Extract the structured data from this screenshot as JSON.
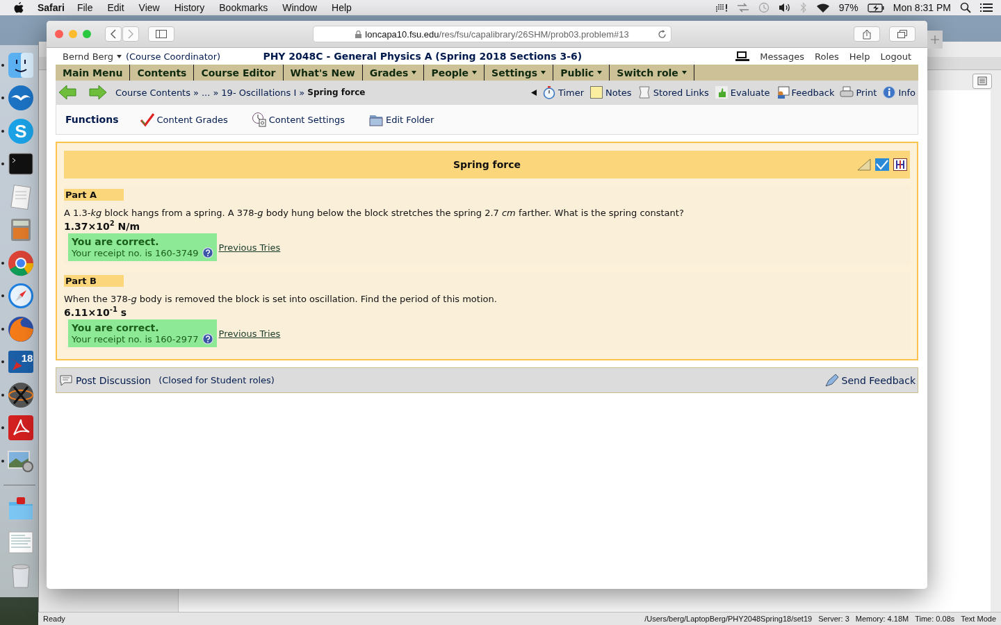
{
  "menubar": {
    "app_name": "Safari",
    "menus": [
      "File",
      "Edit",
      "View",
      "History",
      "Bookmarks",
      "Window",
      "Help"
    ],
    "battery": "97%",
    "clock": "Mon 8:31 PM"
  },
  "dock": [
    {
      "kind": "finder",
      "running": true
    },
    {
      "kind": "gull",
      "running": true
    },
    {
      "kind": "skype",
      "running": true,
      "badge": "S"
    },
    {
      "kind": "terminal",
      "running": true
    },
    {
      "kind": "notepad",
      "running": false
    },
    {
      "kind": "calculator",
      "running": false
    },
    {
      "kind": "chrome",
      "running": true
    },
    {
      "kind": "compass",
      "running": true
    },
    {
      "kind": "globe",
      "running": true
    },
    {
      "kind": "calendar",
      "running": true,
      "badge": "18"
    },
    {
      "kind": "xmark",
      "running": true
    },
    {
      "kind": "pdf",
      "running": true
    },
    {
      "kind": "photo",
      "running": true
    },
    {
      "kind": "divider"
    },
    {
      "kind": "folder",
      "running": false
    },
    {
      "kind": "document",
      "running": false
    },
    {
      "kind": "trash",
      "running": false
    }
  ],
  "browser": {
    "url_host": "loncapa10.fsu.edu",
    "url_path": "/res/fsu/capalibrary/26SHM/prob03.problem#13"
  },
  "header": {
    "user": "Bernd Berg",
    "role": "(Course Coordinator)",
    "course": "PHY 2048C - General Physics A (Spring 2018 Sections 3-6)",
    "links": [
      "Messages",
      "Roles",
      "Help",
      "Logout"
    ]
  },
  "nav": [
    {
      "label": "Main Menu",
      "dropdown": false
    },
    {
      "label": "Contents",
      "dropdown": false
    },
    {
      "label": "Course Editor",
      "dropdown": false
    },
    {
      "label": "What's New",
      "dropdown": false
    },
    {
      "label": "Grades",
      "dropdown": true
    },
    {
      "label": "People",
      "dropdown": true
    },
    {
      "label": "Settings",
      "dropdown": true
    },
    {
      "label": "Public",
      "dropdown": true
    },
    {
      "label": "Switch role",
      "dropdown": true
    }
  ],
  "breadcrumbs": [
    {
      "kind": "link",
      "label": "Course Contents"
    },
    {
      "kind": "sep",
      "label": "»"
    },
    {
      "kind": "link",
      "label": "..."
    },
    {
      "kind": "sep",
      "label": "»"
    },
    {
      "kind": "link",
      "label": "19- Oscillations I"
    },
    {
      "kind": "sep",
      "label": "»"
    },
    {
      "kind": "current",
      "label": "Spring force"
    }
  ],
  "tools": [
    {
      "kind": "stopwatch",
      "label": "Timer"
    },
    {
      "kind": "note",
      "label": "Notes"
    },
    {
      "kind": "scroll",
      "label": "Stored Links"
    },
    {
      "kind": "thumb",
      "label": "Evaluate"
    },
    {
      "kind": "feedback",
      "label": "Feedback"
    },
    {
      "kind": "printer",
      "label": "Print"
    },
    {
      "kind": "info",
      "label": "Info"
    }
  ],
  "functions": {
    "title": "Functions",
    "items": [
      {
        "kind": "check",
        "label": "Content Grades"
      },
      {
        "kind": "clock",
        "label": "Content Settings"
      },
      {
        "kind": "folder",
        "label": "Edit Folder"
      }
    ]
  },
  "problem": {
    "title": "Spring force",
    "parts": [
      {
        "label": "Part A",
        "question": "A 1.3-*kg* block hangs from a spring. A 378-*g* body hung below the block stretches the spring 2.7 *cm* farther. What is the spring constant?",
        "answer": "1.37×10$^{2}$ N/m",
        "correct": true,
        "status": "You are correct.",
        "receipt": "Your receipt no. is 160-3749",
        "link": "Previous Tries"
      },
      {
        "label": "Part B",
        "question": "When the 378-*g* body is removed the block is set into oscillation. Find the period of this motion.",
        "answer": "6.11×10$^{-1}$ s",
        "correct": true,
        "status": "You are correct.",
        "receipt": "Your receipt no. is 160-2977",
        "link": "Previous Tries"
      }
    ]
  },
  "footer": {
    "discussion": "Post Discussion",
    "note": "(Closed for Student roles)",
    "feedback": "Send Feedback"
  },
  "status_bar": {
    "left": "Ready",
    "items": [
      "/Users/berg/LaptopBerg/PHY2048Spring18/set19",
      "Server: 3",
      "Memory: 4.18M",
      "Time: 0.08s",
      "Text Mode"
    ]
  }
}
